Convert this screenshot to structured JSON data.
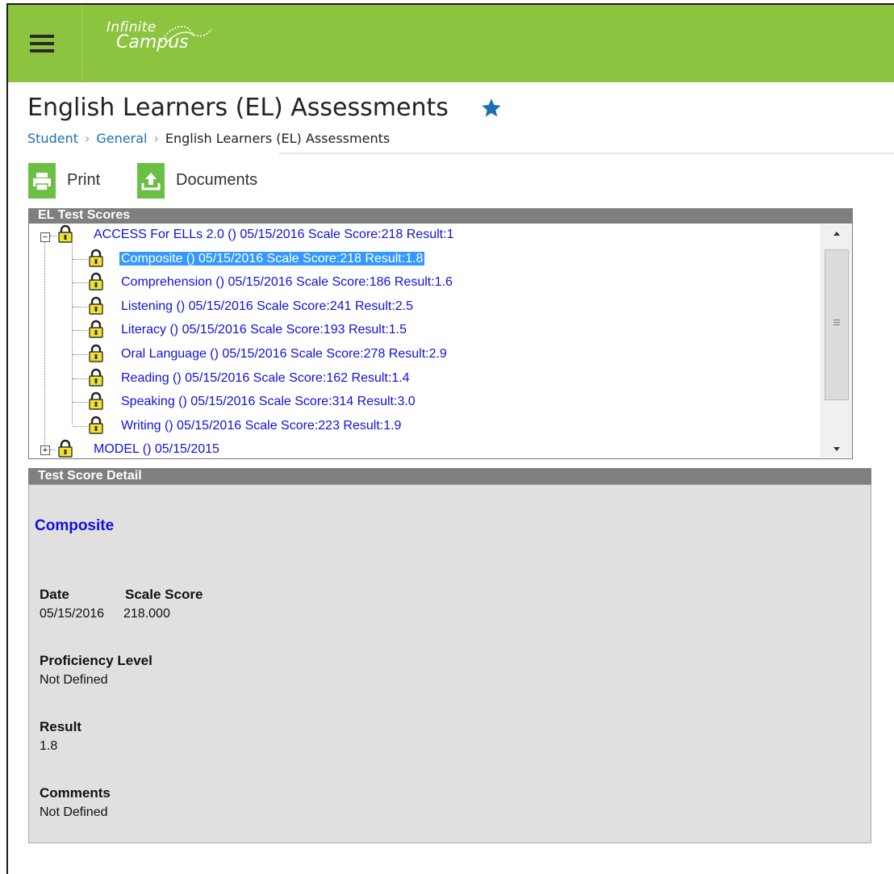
{
  "app": {
    "logo_line1": "Infinite",
    "logo_line2": "Campus"
  },
  "page": {
    "title": "English Learners (EL) Assessments"
  },
  "breadcrumb": [
    {
      "label": "Student"
    },
    {
      "label": "General"
    },
    {
      "label": "English Learners (EL) Assessments"
    }
  ],
  "toolbar": {
    "print_label": "Print",
    "documents_label": "Documents"
  },
  "tree": {
    "header": "EL Test Scores",
    "parent": "ACCESS For ELLs 2.0 () 05/15/2016 Scale Score:218 Result:1",
    "children": [
      "Composite () 05/15/2016 Scale Score:218 Result:1.8",
      "Comprehension () 05/15/2016 Scale Score:186 Result:1.6",
      "Listening () 05/15/2016 Scale Score:241 Result:2.5",
      "Literacy () 05/15/2016 Scale Score:193 Result:1.5",
      "Oral Language () 05/15/2016 Scale Score:278 Result:2.9",
      "Reading () 05/15/2016 Scale Score:162 Result:1.4",
      "Speaking () 05/15/2016 Scale Score:314 Result:3.0",
      "Writing () 05/15/2016 Scale Score:223 Result:1.9"
    ],
    "collapsed_parent": "MODEL () 05/15/2015",
    "selected_index": 0
  },
  "detail": {
    "header": "Test Score Detail",
    "name": "Composite",
    "date_label": "Date",
    "scale_score_label": "Scale Score",
    "date_value": "05/15/2016",
    "scale_score_value": "218.000",
    "proficiency_label": "Proficiency Level",
    "proficiency_value": "Not Defined",
    "result_label": "Result",
    "result_value": "1.8",
    "comments_label": "Comments",
    "comments_value": "Not Defined"
  },
  "colors": {
    "topbar": "#8cc43f",
    "toolbar_icon": "#6cbf45",
    "star": "#1a6fb5",
    "link": "#1010e0",
    "selection": "#3399ff"
  }
}
